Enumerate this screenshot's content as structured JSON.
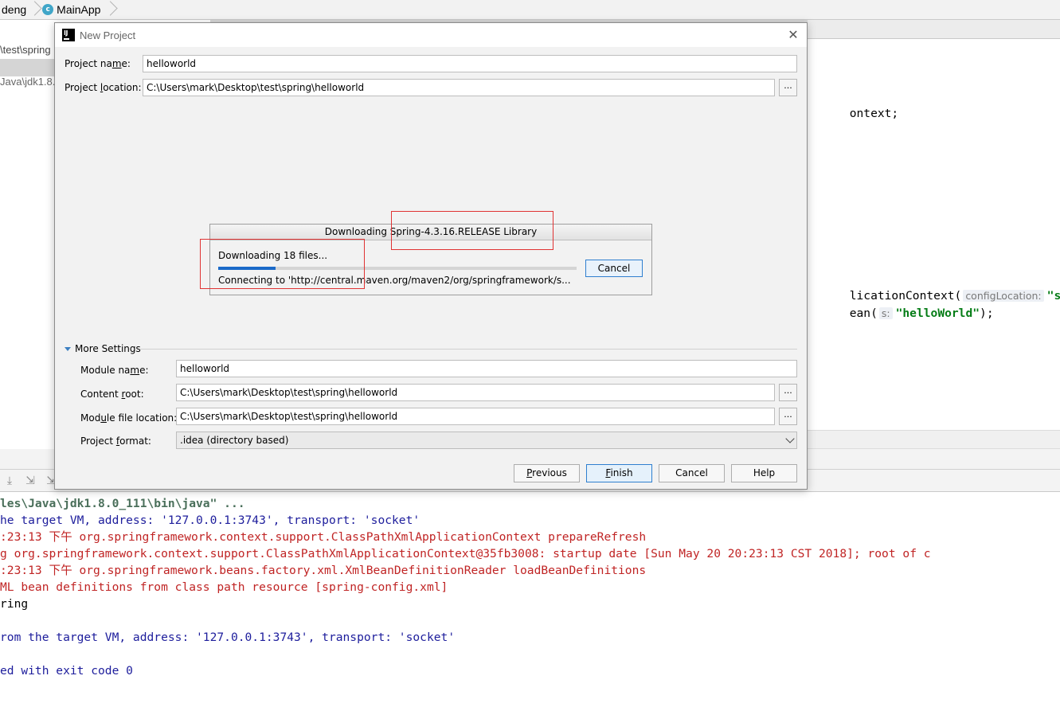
{
  "breadcrumb": {
    "items": [
      "deng",
      "MainApp"
    ]
  },
  "project_tree": {
    "rows": [
      "\\test\\spring",
      "",
      "Java\\jdk1.8."
    ]
  },
  "editor": {
    "line1": "ontext;",
    "line2_prefix": "licationContext(",
    "line2_hint": "configLocation:",
    "line2_str": "\"spr",
    "line3_prefix": "ean(",
    "line3_hint": "s:",
    "line3_str": "\"helloWorld\"",
    "line3_suffix": ");"
  },
  "console": {
    "lines": [
      "les\\Java\\jdk1.8.0_111\\bin\\java\" ...",
      "he target VM, address: '127.0.0.1:3743', transport: 'socket'",
      ":23:13 下午 org.springframework.context.support.ClassPathXmlApplicationContext prepareRefresh",
      "g org.springframework.context.support.ClassPathXmlApplicationContext@35fb3008: startup date [Sun May 20 20:23:13 CST 2018]; root of c",
      ":23:13 下午 org.springframework.beans.factory.xml.XmlBeanDefinitionReader loadBeanDefinitions",
      "ML bean definitions from class path resource [spring-config.xml]",
      "ring",
      "",
      "rom the target VM, address: '127.0.0.1:3743', transport: 'socket'",
      "",
      "ed with exit code 0"
    ]
  },
  "dialog": {
    "title": "New Project",
    "project_name_label_pre": "Project na",
    "project_name_label_u": "m",
    "project_name_label_post": "e:",
    "project_name_value": "helloworld",
    "project_location_label_pre": "Project ",
    "project_location_label_u": "l",
    "project_location_label_post": "ocation:",
    "project_location_value": "C:\\Users\\mark\\Desktop\\test\\spring\\helloworld",
    "browse_label": "...",
    "progress": {
      "title": "Downloading Spring-4.3.16.RELEASE Library",
      "message": "Downloading 18 files...",
      "fraction": 0.16,
      "detail": "Connecting to 'http://central.maven.org/maven2/org/springframework/s...",
      "cancel_label": "Cancel"
    },
    "more_settings_label": "More Settings",
    "module_name_label_pre": "Module na",
    "module_name_label_u": "m",
    "module_name_label_post": "e:",
    "module_name_value": "helloworld",
    "content_root_label_pre": "Content ",
    "content_root_label_u": "r",
    "content_root_label_post": "oot:",
    "content_root_value": "C:\\Users\\mark\\Desktop\\test\\spring\\helloworld",
    "module_file_label_pre": "Mod",
    "module_file_label_u": "u",
    "module_file_label_post": "le file location:",
    "module_file_value": "C:\\Users\\mark\\Desktop\\test\\spring\\helloworld",
    "project_format_label_pre": "Project ",
    "project_format_label_u": "f",
    "project_format_label_post": "ormat:",
    "project_format_value": ".idea (directory based)",
    "buttons": {
      "previous_u": "P",
      "previous_rest": "revious",
      "finish_u": "F",
      "finish_rest": "inish",
      "cancel": "Cancel",
      "help": "Help"
    }
  },
  "colors": {
    "accent": "#2f7fcf",
    "progress_fill": "#1b6ac9",
    "highlight_box": "#e03333",
    "console_error": "#c02424",
    "console_info": "#1d1d9c"
  }
}
